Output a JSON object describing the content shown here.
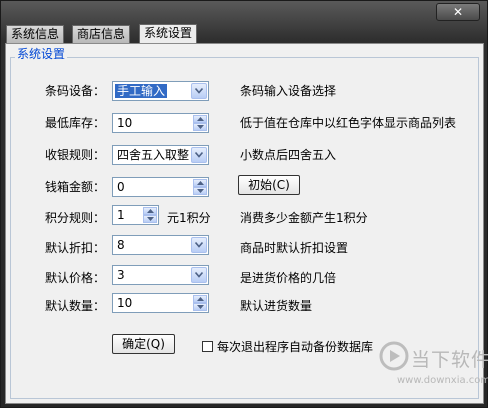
{
  "window": {
    "close_glyph": "✕"
  },
  "tabs": [
    {
      "label": "系统信息",
      "active": false
    },
    {
      "label": "商店信息",
      "active": false
    },
    {
      "label": "系统设置",
      "active": true
    }
  ],
  "group": {
    "title": "系统设置"
  },
  "settings": {
    "barcode": {
      "label": "条码设备：",
      "value": "手工输入",
      "hint": "条码输入设备选择"
    },
    "min_stock": {
      "label": "最低库存：",
      "value": "10",
      "hint": "低于值在仓库中以红色字体显示商品列表"
    },
    "rounding": {
      "label": "收银规则：",
      "value": "四舍五入取整",
      "hint": "小数点后四舍五入"
    },
    "cash_box": {
      "label": "钱箱金额：",
      "value": "0",
      "button": "初始(C)"
    },
    "points": {
      "label": "积分规则：",
      "value": "1",
      "unit": "元1积分",
      "hint": "消费多少金额产生1积分"
    },
    "discount": {
      "label": "默认折扣：",
      "value": "8",
      "hint": "商品时默认折扣设置"
    },
    "price": {
      "label": "默认价格：",
      "value": "3",
      "hint": "是进货价格的几倍"
    },
    "quantity": {
      "label": "默认数量：",
      "value": "10",
      "hint": "默认进货数量"
    }
  },
  "footer": {
    "ok_button": "确定(Q)",
    "backup_checkbox_label": "每次退出程序自动备份数据库",
    "backup_checked": false
  },
  "watermark": {
    "name": "当下软件园",
    "url": "www.downxia.com"
  },
  "colors": {
    "group_title": "#0046d5",
    "selection": "#316ac5"
  }
}
